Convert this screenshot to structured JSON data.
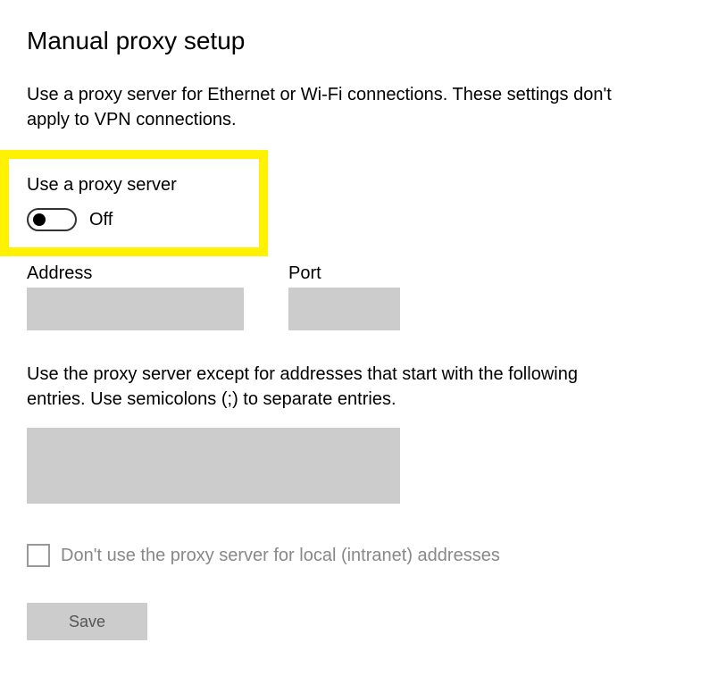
{
  "section": {
    "title": "Manual proxy setup",
    "description": "Use a proxy server for Ethernet or Wi-Fi connections. These settings don't apply to VPN connections."
  },
  "toggle": {
    "label": "Use a proxy server",
    "state": "Off"
  },
  "address": {
    "label": "Address",
    "value": ""
  },
  "port": {
    "label": "Port",
    "value": ""
  },
  "exceptions": {
    "description": "Use the proxy server except for addresses that start with the following entries. Use semicolons (;) to separate entries.",
    "value": ""
  },
  "local": {
    "label": "Don't use the proxy server for local (intranet) addresses",
    "checked": false
  },
  "save": {
    "label": "Save"
  }
}
